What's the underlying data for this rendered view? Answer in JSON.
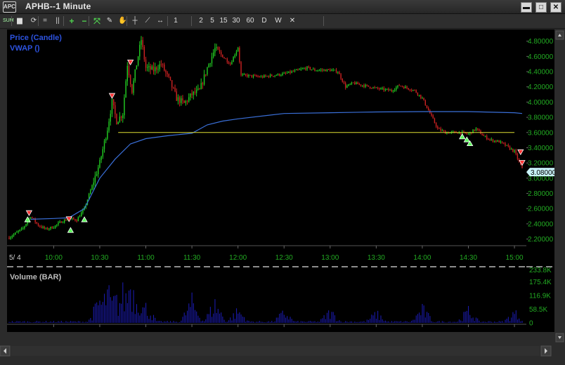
{
  "window": {
    "icon_text": "APC",
    "title": "APHB--1 Minute",
    "buttons": {
      "minimize": "▬",
      "maximize": "□",
      "close": "✕"
    }
  },
  "toolbar": {
    "items": [
      {
        "name": "sum-button",
        "label": "SUM"
      },
      {
        "name": "chart-type-icon",
        "label": "▆"
      },
      {
        "name": "refresh-icon",
        "label": "⟳"
      },
      {
        "name": "equals-icon",
        "label": "="
      },
      {
        "name": "pause-icon",
        "label": "||"
      },
      {
        "name": "zoom-in-icon",
        "label": "+"
      },
      {
        "name": "zoom-out-icon",
        "label": "−"
      },
      {
        "name": "fit-icon",
        "label": "⤧"
      },
      {
        "name": "pencil-icon",
        "label": "✎"
      },
      {
        "name": "hand-icon",
        "label": "✋"
      },
      {
        "name": "crosshair-icon",
        "label": "┼"
      },
      {
        "name": "line-tool-icon",
        "label": "⟋"
      },
      {
        "name": "pan-icon",
        "label": "↔"
      },
      {
        "name": "interval-1",
        "label": "1"
      },
      {
        "name": "interval-2",
        "label": "2"
      },
      {
        "name": "interval-5",
        "label": "5"
      },
      {
        "name": "interval-15",
        "label": "15"
      },
      {
        "name": "interval-30",
        "label": "30"
      },
      {
        "name": "interval-60",
        "label": "60"
      },
      {
        "name": "interval-D",
        "label": "D"
      },
      {
        "name": "interval-W",
        "label": "W"
      },
      {
        "name": "close-chart-icon",
        "label": "✕"
      }
    ]
  },
  "legend": {
    "price": "Price (Candle)",
    "vwap": "VWAP ()",
    "volume": "Volume (BAR)"
  },
  "price_axis": {
    "ticks": [
      "4.80000",
      "4.60000",
      "4.40000",
      "4.20000",
      "4.00000",
      "3.80000",
      "3.60000",
      "3.40000",
      "3.20000",
      "3.00000",
      "2.80000",
      "2.60000",
      "2.40000",
      "2.20000"
    ],
    "current": "3.08000"
  },
  "volume_axis": {
    "ticks": [
      "233.8K",
      "175.4K",
      "116.9K",
      "58.5K",
      "0"
    ]
  },
  "time_axis": {
    "date": "5/ 4",
    "ticks": [
      "10:00",
      "10:30",
      "11:00",
      "11:30",
      "12:00",
      "12:30",
      "13:00",
      "13:30",
      "14:00",
      "14:30",
      "15:00"
    ]
  },
  "colors": {
    "up": "#22cc22",
    "down": "#cc2222",
    "vwap": "#3a6fd8",
    "volume": "#1a1aa8",
    "hline": "#dddd33",
    "axis_text": "#22aa22",
    "legend": "#2d53e0",
    "current_price_box": "#c9f3f8"
  },
  "chart_data": {
    "type": "candlestick",
    "symbol": "APHB",
    "interval": "1 Minute",
    "price_range": [
      2.15,
      4.88
    ],
    "volume_range": [
      0,
      233800
    ],
    "price_path": [
      [
        "9:31",
        2.22
      ],
      [
        "9:40",
        2.34
      ],
      [
        "9:45",
        2.5
      ],
      [
        "9:50",
        2.38
      ],
      [
        "9:55",
        2.33
      ],
      [
        "10:00",
        2.36
      ],
      [
        "10:05",
        2.43
      ],
      [
        "10:10",
        2.47
      ],
      [
        "10:15",
        2.45
      ],
      [
        "10:20",
        2.6
      ],
      [
        "10:25",
        2.9
      ],
      [
        "10:30",
        3.2
      ],
      [
        "10:35",
        3.65
      ],
      [
        "10:38",
        4.0
      ],
      [
        "10:41",
        3.75
      ],
      [
        "10:45",
        3.85
      ],
      [
        "10:48",
        4.5
      ],
      [
        "10:51",
        4.15
      ],
      [
        "10:54",
        4.5
      ],
      [
        "10:57",
        4.82
      ],
      [
        "11:00",
        4.45
      ],
      [
        "11:05",
        4.42
      ],
      [
        "11:10",
        4.5
      ],
      [
        "11:15",
        4.3
      ],
      [
        "11:20",
        4.05
      ],
      [
        "11:25",
        3.98
      ],
      [
        "11:30",
        4.1
      ],
      [
        "11:35",
        4.15
      ],
      [
        "11:40",
        4.45
      ],
      [
        "11:45",
        4.7
      ],
      [
        "11:50",
        4.6
      ],
      [
        "11:55",
        4.5
      ],
      [
        "12:00",
        4.72
      ],
      [
        "12:02",
        4.35
      ],
      [
        "12:05",
        4.35
      ],
      [
        "12:15",
        4.33
      ],
      [
        "12:30",
        4.37
      ],
      [
        "12:45",
        4.45
      ],
      [
        "12:50",
        4.42
      ],
      [
        "13:00",
        4.42
      ],
      [
        "13:05",
        4.4
      ],
      [
        "13:10",
        4.2
      ],
      [
        "13:15",
        4.25
      ],
      [
        "13:30",
        4.18
      ],
      [
        "13:40",
        4.15
      ],
      [
        "13:45",
        4.22
      ],
      [
        "13:55",
        4.15
      ],
      [
        "14:00",
        4.05
      ],
      [
        "14:05",
        3.85
      ],
      [
        "14:10",
        3.65
      ],
      [
        "14:15",
        3.6
      ],
      [
        "14:25",
        3.6
      ],
      [
        "14:30",
        3.58
      ],
      [
        "14:35",
        3.65
      ],
      [
        "14:40",
        3.55
      ],
      [
        "14:45",
        3.5
      ],
      [
        "14:50",
        3.48
      ],
      [
        "14:55",
        3.42
      ],
      [
        "15:00",
        3.35
      ],
      [
        "15:05",
        3.12
      ]
    ],
    "vwap_path": [
      [
        "9:45",
        2.46
      ],
      [
        "10:00",
        2.47
      ],
      [
        "10:10",
        2.48
      ],
      [
        "10:20",
        2.6
      ],
      [
        "10:30",
        3.0
      ],
      [
        "10:40",
        3.25
      ],
      [
        "10:50",
        3.45
      ],
      [
        "11:00",
        3.52
      ],
      [
        "11:15",
        3.56
      ],
      [
        "11:30",
        3.59
      ],
      [
        "11:40",
        3.7
      ],
      [
        "11:50",
        3.75
      ],
      [
        "12:00",
        3.78
      ],
      [
        "12:30",
        3.85
      ],
      [
        "13:00",
        3.86
      ],
      [
        "13:30",
        3.87
      ],
      [
        "14:00",
        3.875
      ],
      [
        "14:30",
        3.875
      ],
      [
        "15:00",
        3.86
      ],
      [
        "15:05",
        3.85
      ]
    ],
    "horizontal_line": {
      "price": 3.6,
      "from": "10:42",
      "to": "15:00"
    },
    "signals": [
      {
        "time": "9:44",
        "price": 2.5,
        "dir": "down"
      },
      {
        "time": "9:43",
        "price": 2.5,
        "dir": "up"
      },
      {
        "time": "10:10",
        "price": 2.42,
        "dir": "down"
      },
      {
        "time": "10:11",
        "price": 2.36,
        "dir": "up"
      },
      {
        "time": "10:20",
        "price": 2.5,
        "dir": "up"
      },
      {
        "time": "10:38",
        "price": 4.04,
        "dir": "down"
      },
      {
        "time": "10:50",
        "price": 4.48,
        "dir": "down"
      },
      {
        "time": "14:26",
        "price": 3.59,
        "dir": "up"
      },
      {
        "time": "14:29",
        "price": 3.55,
        "dir": "up"
      },
      {
        "time": "14:31",
        "price": 3.5,
        "dir": "up"
      },
      {
        "time": "15:04",
        "price": 3.3,
        "dir": "down"
      },
      {
        "time": "15:05",
        "price": 3.16,
        "dir": "down"
      }
    ],
    "volume_bursts": [
      [
        "10:30",
        130000
      ],
      [
        "10:35",
        175400
      ],
      [
        "10:40",
        140000
      ],
      [
        "10:45",
        165000
      ],
      [
        "10:50",
        233800
      ],
      [
        "10:55",
        150000
      ],
      [
        "11:00",
        90000
      ],
      [
        "11:30",
        120000
      ],
      [
        "11:45",
        110000
      ],
      [
        "12:00",
        70000
      ],
      [
        "12:30",
        60000
      ],
      [
        "13:00",
        65000
      ],
      [
        "13:30",
        55000
      ],
      [
        "14:00",
        80000
      ],
      [
        "14:30",
        70000
      ],
      [
        "15:00",
        60000
      ]
    ]
  }
}
